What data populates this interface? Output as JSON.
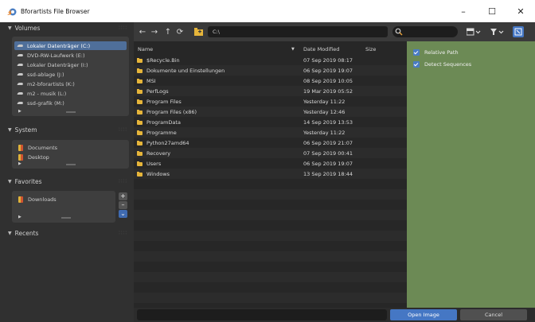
{
  "window": {
    "title": "Bforartists File Browser",
    "minimize": "–",
    "maximize": "☐",
    "close": "✕"
  },
  "sidebar": {
    "volumes": {
      "header": "Volumes",
      "items": [
        {
          "label": "Lokaler Datenträger (C:)",
          "selected": true
        },
        {
          "label": "DVD-RW-Laufwerk (E:)",
          "selected": false
        },
        {
          "label": "Lokaler Datenträger (I:)",
          "selected": false
        },
        {
          "label": "ssd-ablage (J:)",
          "selected": false
        },
        {
          "label": "m2-bforartists (K:)",
          "selected": false
        },
        {
          "label": "m2 - musik (L:)",
          "selected": false
        },
        {
          "label": "ssd-grafik (M:)",
          "selected": false
        }
      ]
    },
    "system": {
      "header": "System",
      "items": [
        {
          "label": "Documents"
        },
        {
          "label": "Desktop"
        }
      ]
    },
    "favorites": {
      "header": "Favorites",
      "items": [
        {
          "label": "Downloads"
        }
      ],
      "add": "+",
      "remove": "–",
      "more": "⌄"
    },
    "recents": {
      "header": "Recents"
    }
  },
  "toolbar": {
    "back": "←",
    "forward": "→",
    "parent": "↑",
    "refresh": "⟳",
    "path": "C:\\"
  },
  "list": {
    "columns": {
      "name": "Name",
      "date": "Date Modified",
      "size": "Size"
    },
    "rows": [
      {
        "name": "$Recycle.Bin",
        "date": "07 Sep 2019 08:17"
      },
      {
        "name": "Dokumente und Einstellungen",
        "date": "06 Sep 2019 19:07"
      },
      {
        "name": "MSI",
        "date": "08 Sep 2019 10:05"
      },
      {
        "name": "PerfLogs",
        "date": "19 Mar 2019 05:52"
      },
      {
        "name": "Program Files",
        "date": "Yesterday 11:22"
      },
      {
        "name": "Program Files (x86)",
        "date": "Yesterday 12:46"
      },
      {
        "name": "ProgramData",
        "date": "14 Sep 2019 13:53"
      },
      {
        "name": "Programme",
        "date": "Yesterday 11:22"
      },
      {
        "name": "Python27amd64",
        "date": "06 Sep 2019 21:07"
      },
      {
        "name": "Recovery",
        "date": "07 Sep 2019 00:41"
      },
      {
        "name": "Users",
        "date": "06 Sep 2019 19:07"
      },
      {
        "name": "Windows",
        "date": "13 Sep 2019 18:44"
      }
    ]
  },
  "options": {
    "relative_path": {
      "label": "Relative Path",
      "checked": true
    },
    "detect_sequences": {
      "label": "Detect Sequences",
      "checked": true
    }
  },
  "footer": {
    "open": "Open Image",
    "cancel": "Cancel"
  },
  "colors": {
    "accent": "#4577c4",
    "options_panel": "#6c8a55",
    "selected_volume": "#4f6f9a"
  }
}
